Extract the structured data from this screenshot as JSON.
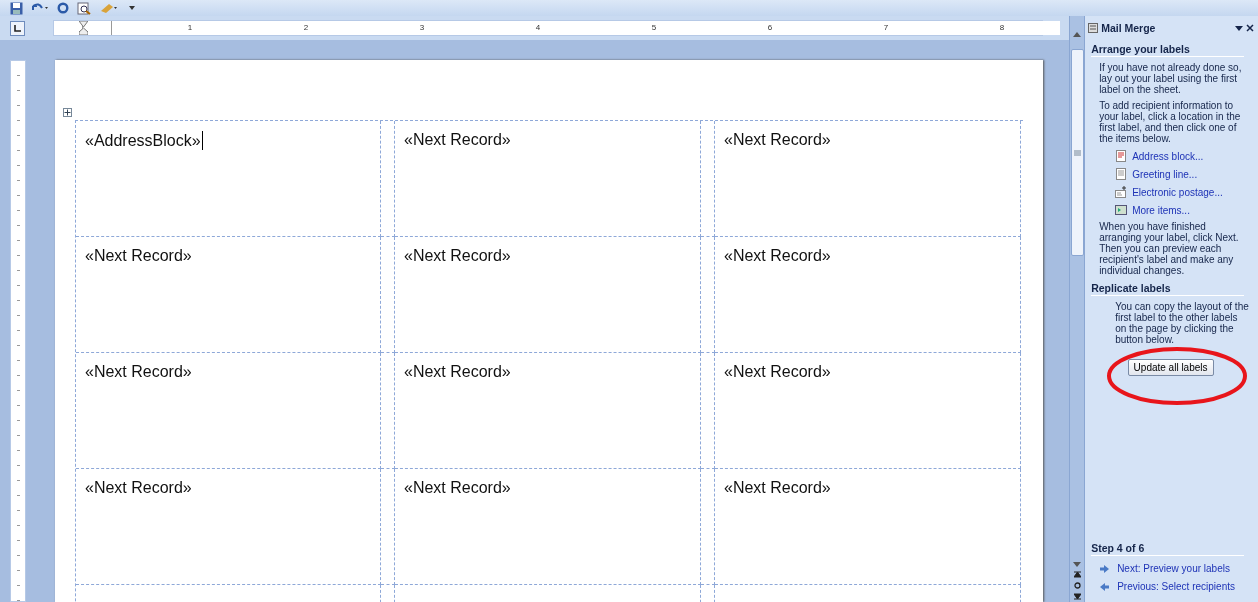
{
  "ruler": {
    "numbers": [
      "1",
      "2",
      "3",
      "4",
      "5",
      "6",
      "7",
      "8"
    ]
  },
  "labels": {
    "rows": [
      [
        "«AddressBlock»",
        "«Next Record»",
        "«Next Record»"
      ],
      [
        "«Next Record»",
        "«Next Record»",
        "«Next Record»"
      ],
      [
        "«Next Record»",
        "«Next Record»",
        "«Next Record»"
      ],
      [
        "«Next Record»",
        "«Next Record»",
        "«Next Record»"
      ]
    ]
  },
  "task_pane": {
    "title": "Mail Merge",
    "arrange": {
      "heading": "Arrange your labels",
      "intro": [
        "If you have not already done so, lay out your label using the first label on the sheet.",
        "To add recipient information to your label, click a location in the first label, and then click one of the items below."
      ],
      "items": [
        {
          "kind": "address",
          "label": "Address block..."
        },
        {
          "kind": "greeting",
          "label": "Greeting line..."
        },
        {
          "kind": "postage",
          "label": "Electronic postage..."
        },
        {
          "kind": "more",
          "label": "More items..."
        }
      ],
      "outro": "When you have finished arranging your label, click Next. Then you can preview each recipient's label and make any individual changes."
    },
    "replicate": {
      "heading": "Replicate labels",
      "text": "You can copy the layout of the first label to the other labels on the page by clicking the button below.",
      "button": "Update all labels"
    },
    "step": {
      "heading": "Step 4 of 6",
      "next": "Next: Preview your labels",
      "previous": "Previous: Select recipients"
    }
  }
}
